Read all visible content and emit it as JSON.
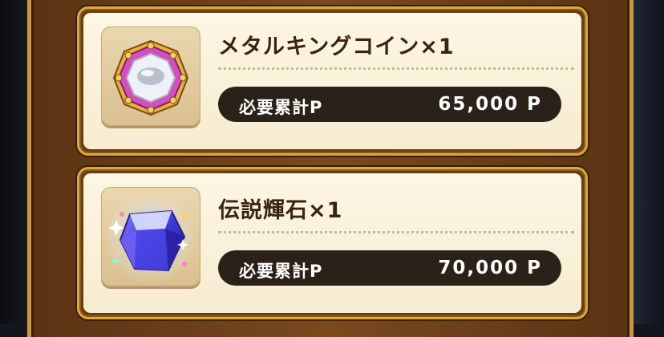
{
  "rewards": [
    {
      "name": "メタルキングコイン×1",
      "label": "必要累計P",
      "value": "65,000 P",
      "icon": "metal-king-coin-icon"
    },
    {
      "name": "伝説輝石×1",
      "label": "必要累計P",
      "value": "70,000 P",
      "icon": "legend-gem-icon"
    }
  ],
  "colors": {
    "frame": "#7a4a1e",
    "gold_border": "#d8aa3c",
    "card_bg": "#fdf6e3",
    "pill_bg": "#2b2118",
    "text_dark": "#3a2310"
  }
}
